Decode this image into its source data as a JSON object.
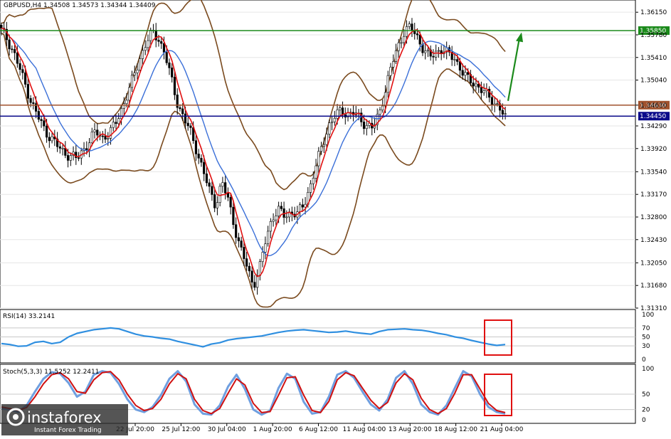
{
  "chart_data": [
    {
      "type": "candlestick",
      "title": "GBPUSD,H4  1.34508 1.34573 1.34344 1.34409",
      "indicators_shown": [
        "Bollinger Bands (brown)",
        "moving average (red)",
        "moving average (blue)"
      ],
      "ylim": [
        1.3131,
        1.3635
      ],
      "y_ticks": [
        "1.36150",
        "1.35780",
        "1.35410",
        "1.35040",
        "1.34630",
        "1.34290",
        "1.33920",
        "1.33540",
        "1.33170",
        "1.32800",
        "1.32430",
        "1.32050",
        "1.31680",
        "1.31310"
      ],
      "x_ticks": [
        "22 Jul 20:00",
        "25 Jul 12:00",
        "30 Jul 04:00",
        "1 Aug 20:00",
        "6 Aug 12:00",
        "11 Aug 04:00",
        "13 Aug 20:00",
        "18 Aug 12:00",
        "21 Aug 04:00"
      ],
      "close_path": [
        1.3585,
        1.357,
        1.3548,
        1.352,
        1.349,
        1.3462,
        1.344,
        1.342,
        1.3408,
        1.3395,
        1.3385,
        1.338,
        1.3375,
        1.339,
        1.3405,
        1.342,
        1.341,
        1.3415,
        1.343,
        1.3455,
        1.348,
        1.351,
        1.354,
        1.3565,
        1.3582,
        1.3572,
        1.3545,
        1.3505,
        1.3465,
        1.344,
        1.342,
        1.339,
        1.3355,
        1.3325,
        1.33,
        1.3335,
        1.331,
        1.3265,
        1.3225,
        1.32,
        1.3168,
        1.3195,
        1.3245,
        1.328,
        1.329,
        1.3282,
        1.3288,
        1.3284,
        1.33,
        1.333,
        1.3365,
        1.34,
        1.343,
        1.3445,
        1.3455,
        1.3448,
        1.345,
        1.344,
        1.343,
        1.3425,
        1.345,
        1.349,
        1.353,
        1.356,
        1.3585,
        1.359,
        1.3575,
        1.3555,
        1.354,
        1.355,
        1.3555,
        1.3545,
        1.354,
        1.352,
        1.3505,
        1.35,
        1.349,
        1.348,
        1.347,
        1.346,
        1.3441
      ],
      "price_lines": [
        {
          "value": 1.3585,
          "label": "1.35850",
          "color": "#1b8a1b"
        },
        {
          "value": 1.3463,
          "label": "1.34630",
          "color": "#a0522d"
        },
        {
          "value": 1.3445,
          "label": "1.34450",
          "color": "#0a0a8a"
        }
      ],
      "annotation": {
        "type": "arrow",
        "color": "#1b8a1b",
        "direction": "up"
      }
    },
    {
      "type": "line",
      "title": "RSI(14) 33.2141",
      "ylim": [
        0,
        100
      ],
      "y_ticks": [
        "100",
        "70",
        "50",
        "30",
        "0"
      ],
      "levels": [
        70,
        50,
        30
      ],
      "values": [
        35,
        33,
        29,
        30,
        38,
        40,
        35,
        38,
        50,
        58,
        62,
        66,
        68,
        70,
        68,
        62,
        56,
        52,
        50,
        47,
        45,
        40,
        36,
        32,
        28,
        34,
        37,
        43,
        46,
        48,
        50,
        52,
        56,
        60,
        63,
        65,
        66,
        64,
        62,
        60,
        61,
        63,
        60,
        58,
        56,
        62,
        66,
        67,
        68,
        66,
        65,
        62,
        58,
        55,
        50,
        47,
        42,
        38,
        34,
        31,
        33
      ]
    },
    {
      "type": "line",
      "title": "Stoch(5,3,3) 11.5252 12.2411",
      "ylim": [
        0,
        100
      ],
      "y_ticks": [
        "100",
        "50",
        "20",
        "0"
      ],
      "levels": [
        50,
        20
      ],
      "main_values": [
        22,
        20,
        15,
        28,
        55,
        80,
        93,
        90,
        72,
        45,
        55,
        88,
        95,
        92,
        70,
        40,
        20,
        15,
        25,
        48,
        80,
        95,
        75,
        30,
        12,
        10,
        28,
        65,
        88,
        60,
        20,
        10,
        18,
        62,
        90,
        80,
        35,
        12,
        15,
        45,
        88,
        95,
        82,
        55,
        30,
        18,
        40,
        82,
        95,
        70,
        30,
        15,
        10,
        28,
        62,
        95,
        85,
        50,
        25,
        15,
        12
      ],
      "signal_values": [
        25,
        22,
        18,
        24,
        45,
        70,
        88,
        92,
        80,
        55,
        52,
        78,
        92,
        94,
        78,
        50,
        28,
        18,
        22,
        40,
        70,
        90,
        80,
        40,
        18,
        12,
        22,
        52,
        80,
        68,
        32,
        14,
        16,
        48,
        82,
        84,
        48,
        18,
        14,
        36,
        78,
        92,
        86,
        62,
        38,
        22,
        34,
        72,
        90,
        78,
        42,
        20,
        12,
        22,
        52,
        88,
        88,
        60,
        32,
        18,
        14
      ]
    }
  ],
  "watermark": {
    "brand": "instaforex",
    "tagline": "Instant Forex Trading"
  }
}
